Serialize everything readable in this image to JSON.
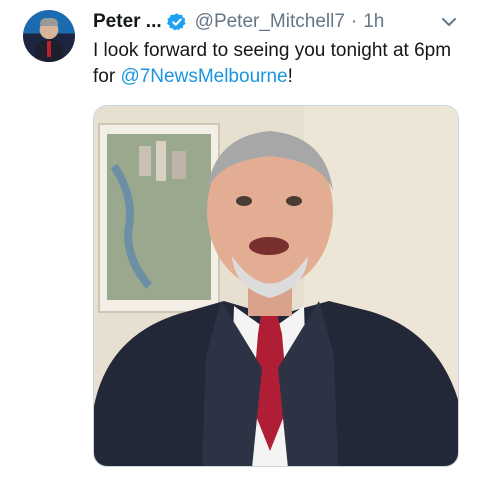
{
  "tweet": {
    "author_name": "Peter ...",
    "verified": true,
    "handle": "@Peter_Mitchell7",
    "separator": "·",
    "time": "1h",
    "text_before": "I look forward to seeing you tonight at 6pm for ",
    "mention": "@7NewsMelbourne",
    "text_after": "!",
    "media_type": "video",
    "icons": [
      "avatar",
      "verified-badge-icon",
      "chevron-down-icon"
    ]
  },
  "colors": {
    "link": "#1b95e0",
    "secondary_text": "#657786",
    "primary_text": "#14171a",
    "verified_badge": "#1da1f2"
  }
}
